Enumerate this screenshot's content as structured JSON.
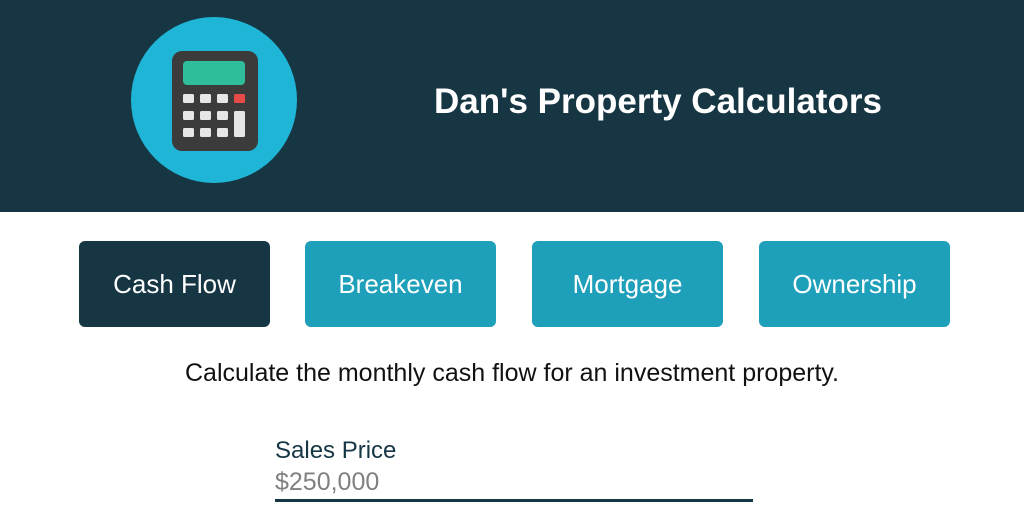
{
  "header": {
    "logo_icon": "calculator-icon",
    "title": "Dan's Property Calculators"
  },
  "tabs": [
    {
      "label": "Cash Flow",
      "active": true
    },
    {
      "label": "Breakeven",
      "active": false
    },
    {
      "label": "Mortgage",
      "active": false
    },
    {
      "label": "Ownership",
      "active": false
    }
  ],
  "main": {
    "description": "Calculate the monthly cash flow for an investment property.",
    "sales_price": {
      "label": "Sales Price",
      "value": "",
      "placeholder": "$250,000"
    }
  },
  "colors": {
    "header_bg": "#163644",
    "tab_bg": "#1e9fba",
    "tab_active_bg": "#163644",
    "logo_circle": "#1fb5d6"
  }
}
